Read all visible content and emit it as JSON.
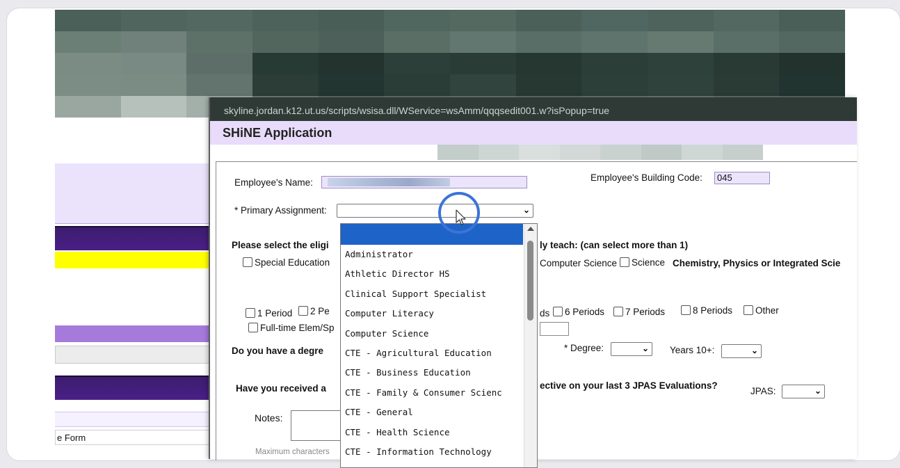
{
  "colors": {
    "accent_purple": "#4a1f86",
    "title_bar": "#e8dcfa",
    "selected_option": "#1e63c8",
    "highlight_ring": "#3b74d6",
    "yellow_bar": "#ffff00"
  },
  "left_page": {
    "bottom_link": "e Form"
  },
  "popup": {
    "url_text": "skyline.jordan.k12.ut.us/scripts/wsisa.dll/WService=wsAmm/qqqsedit001.w?isPopup=true",
    "title": "SHiNE Application",
    "form": {
      "employee_name_label": "Employee's Name:",
      "building_code_label": "Employee's Building Code:",
      "building_code_value": "045",
      "primary_assignment_label": "* Primary Assignment:",
      "eligible_prefix": "Please select the eligi",
      "eligible_suffix": "ly teach: (can select more than 1)",
      "special_ed_label": "Special Education",
      "computer_science_label": "Computer Science",
      "science_label": "Science",
      "science_detail": "Chemistry, Physics or Integrated Scie",
      "period_1": "1 Period",
      "period_2_fragment": "2 Pe",
      "periods_fragment": "ds",
      "period_6": "6 Periods",
      "period_7": "7 Periods",
      "period_8": "8 Periods",
      "other_label": "Other",
      "fulltime_fragment": "Full-time Elem/Sp",
      "degree_question_fragment": "Do you have a degre",
      "degree_label": "* Degree:",
      "years_label": "Years 10+:",
      "received_question_fragment": "Have you received a",
      "effective_fragment": "ective on your last 3 JPAS Evaluations?",
      "jpas_label": "JPAS:",
      "notes_label": "Notes:",
      "max_chars_fragment": "Maximum characters"
    }
  },
  "dropdown": {
    "selected_value": "",
    "options": [
      "",
      "Administrator",
      "Athletic Director HS",
      "Clinical Support Specialist",
      "Computer Literacy",
      "Computer Science",
      "CTE - Agricultural Education",
      "CTE - Business Education",
      "CTE - Family & Consumer Scienc",
      "CTE - General",
      "CTE - Health Science",
      "CTE - Information Technology"
    ]
  }
}
